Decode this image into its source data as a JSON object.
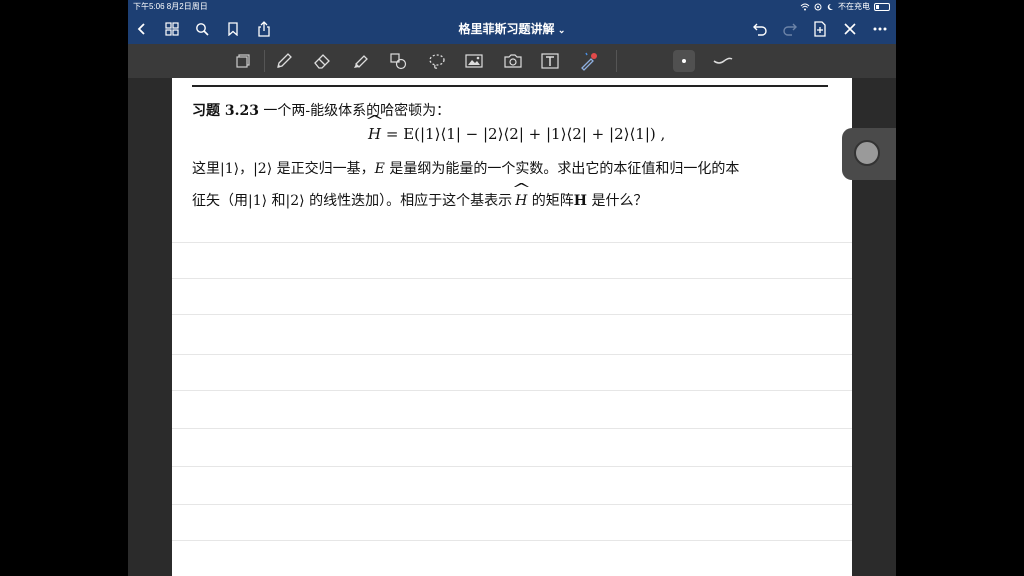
{
  "status_bar": {
    "time_date": "下午5:06   8月2日周日",
    "charging": "不在充电"
  },
  "nav": {
    "title": "格里菲斯习题讲解",
    "title_chevron": "⌄",
    "icons": [
      "back-icon",
      "grid-icon",
      "search-icon",
      "bookmark-icon",
      "share-icon",
      "undo-icon",
      "redo-icon",
      "add-page-icon",
      "close-icon",
      "more-icon"
    ]
  },
  "toolbar": {
    "tools": [
      "page-thumbnail-icon",
      "pen-icon",
      "eraser-icon",
      "highlighter-icon",
      "shapes-icon",
      "lasso-icon",
      "image-icon",
      "camera-icon",
      "text-icon",
      "laser-pointer-icon"
    ],
    "colors": {
      "accent": "#1d3f73",
      "active_dot": "#ffffff"
    }
  },
  "document": {
    "problem_label": "习题 3.23",
    "intro": " 一个两-能级体系的哈密顿为：",
    "eq_lhs": "H",
    "eq_rhs": " = E(|1⟩⟨1| − |2⟩⟨2| + |1⟩⟨2| + |2⟩⟨1|) ,",
    "line2_a": "这里",
    "ket1": "|1⟩",
    "comma": "，",
    "ket2": "|2⟩",
    "line2_b": " 是正交归一基，",
    "line2_E": "E",
    "line2_c": " 是量纲为能量的一个实数。求出它的本征值和归一化的本",
    "line3_a": "征矢（用",
    "line3_ket1": "|1⟩",
    "line3_and": " 和",
    "line3_ket2": "|2⟩",
    "line3_b": " 的线性迭加）。相应于这个基表示",
    "line3_H": "H",
    "line3_c": " 的矩阵",
    "line3_bold": "H",
    "line3_d": " 是什么？"
  }
}
